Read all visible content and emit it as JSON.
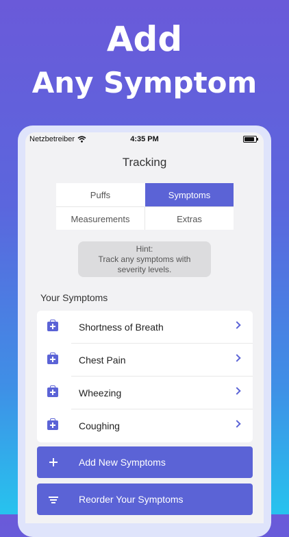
{
  "promo": {
    "line1": "Add",
    "line2": "Any Symptom"
  },
  "status_bar": {
    "carrier": "Netzbetreiber",
    "time": "4:35 PM"
  },
  "nav": {
    "title": "Tracking"
  },
  "segments": [
    {
      "label": "Puffs",
      "active": false
    },
    {
      "label": "Symptoms",
      "active": true
    },
    {
      "label": "Measurements",
      "active": false
    },
    {
      "label": "Extras",
      "active": false
    }
  ],
  "hint": {
    "title": "Hint:",
    "line1": "Track any symptoms with",
    "line2": "severity levels."
  },
  "section_title": "Your Symptoms",
  "symptoms": [
    {
      "label": "Shortness of Breath",
      "icon": "medical-kit-icon"
    },
    {
      "label": "Chest Pain",
      "icon": "medical-kit-icon"
    },
    {
      "label": "Wheezing",
      "icon": "medical-kit-icon"
    },
    {
      "label": "Coughing",
      "icon": "medical-kit-icon"
    }
  ],
  "actions": {
    "add_label": "Add New Symptoms",
    "reorder_label": "Reorder Your Symptoms"
  },
  "colors": {
    "accent": "#5b63d6",
    "background_top": "#6a5ad9",
    "background_bottom": "#27c3ee"
  }
}
